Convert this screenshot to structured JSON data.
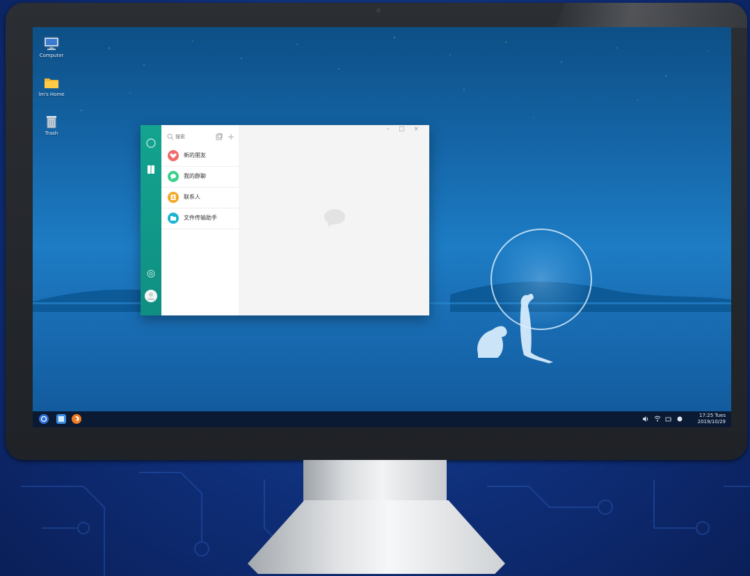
{
  "desktop": {
    "icons": [
      {
        "label": "Computer",
        "icon": "computer-icon"
      },
      {
        "label": "lm's Home",
        "icon": "folder-icon"
      },
      {
        "label": "Trash",
        "icon": "trash-icon"
      }
    ]
  },
  "app_window": {
    "search": {
      "placeholder": "搜索",
      "value": ""
    },
    "controls": "–  □  ×",
    "contacts": [
      {
        "label": "新的朋友",
        "color": "#f06b6b",
        "icon": "heart-icon"
      },
      {
        "label": "我的群聊",
        "color": "#3ecf8e",
        "icon": "chat-icon"
      },
      {
        "label": "联系人",
        "color": "#f5a623",
        "icon": "contact-card-icon"
      },
      {
        "label": "文件传输助手",
        "color": "#19b4d2",
        "icon": "folder-icon"
      }
    ],
    "rail_color": "#13a48f"
  },
  "taskbar": {
    "apps": [
      {
        "icon": "start-menu-icon",
        "color": "#2f6fd6"
      },
      {
        "icon": "file-manager-icon",
        "color": "#3b8de0"
      },
      {
        "icon": "browser-icon",
        "color": "#ee7a22"
      }
    ],
    "tray": [
      "volume-icon",
      "wifi-icon",
      "battery-icon",
      "notification-icon"
    ],
    "clock": {
      "time": "17:25 Tues",
      "date": "2019/10/29"
    }
  }
}
